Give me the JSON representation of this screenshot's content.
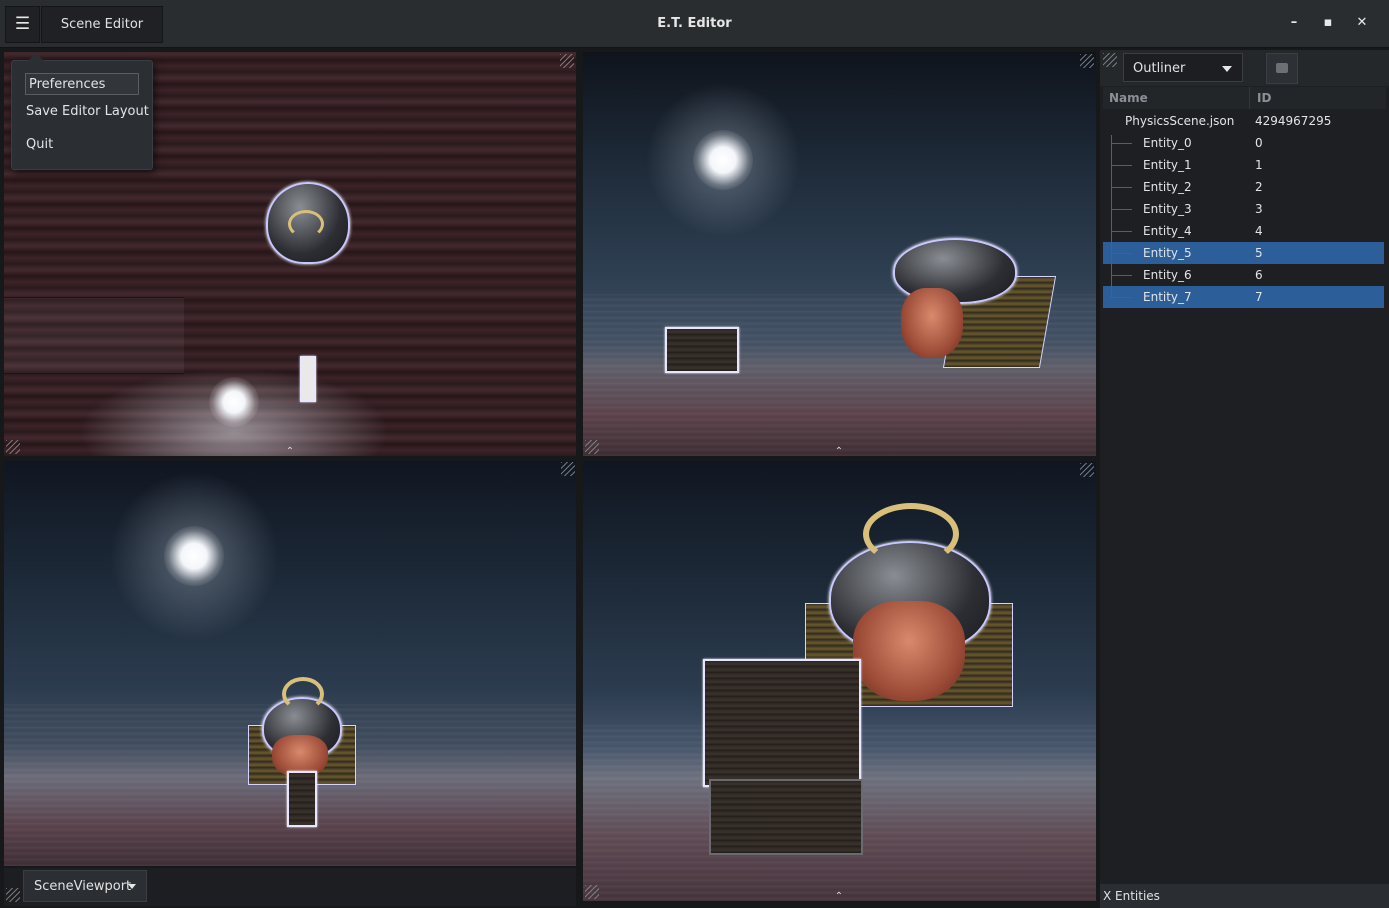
{
  "app": {
    "title": "E.T. Editor",
    "editor_tab": "Scene Editor"
  },
  "window_controls": {
    "minimize": "–",
    "maximize": "▪",
    "close": "✕"
  },
  "menu": {
    "items": [
      "Preferences",
      "Save Editor Layout",
      "Quit"
    ]
  },
  "outliner": {
    "dropdown_label": "Outliner",
    "columns": {
      "name": "Name",
      "id": "ID"
    },
    "root": {
      "name": "PhysicsScene.json",
      "id": "4294967295"
    },
    "entities": [
      {
        "name": "Entity_0",
        "id": "0",
        "selected": false
      },
      {
        "name": "Entity_1",
        "id": "1",
        "selected": false
      },
      {
        "name": "Entity_2",
        "id": "2",
        "selected": false
      },
      {
        "name": "Entity_3",
        "id": "3",
        "selected": false
      },
      {
        "name": "Entity_4",
        "id": "4",
        "selected": false
      },
      {
        "name": "Entity_5",
        "id": "5",
        "selected": true
      },
      {
        "name": "Entity_6",
        "id": "6",
        "selected": false
      },
      {
        "name": "Entity_7",
        "id": "7",
        "selected": true
      }
    ],
    "footer": "X Entities",
    "selection_color": "#2c5e99"
  },
  "viewport_selector": {
    "label": "SceneViewport"
  },
  "icons": [
    "hamburger-icon",
    "minimize-icon",
    "maximize-icon",
    "close-icon",
    "caret-down-icon",
    "resize-corner-icon",
    "chevron-up-icon"
  ]
}
